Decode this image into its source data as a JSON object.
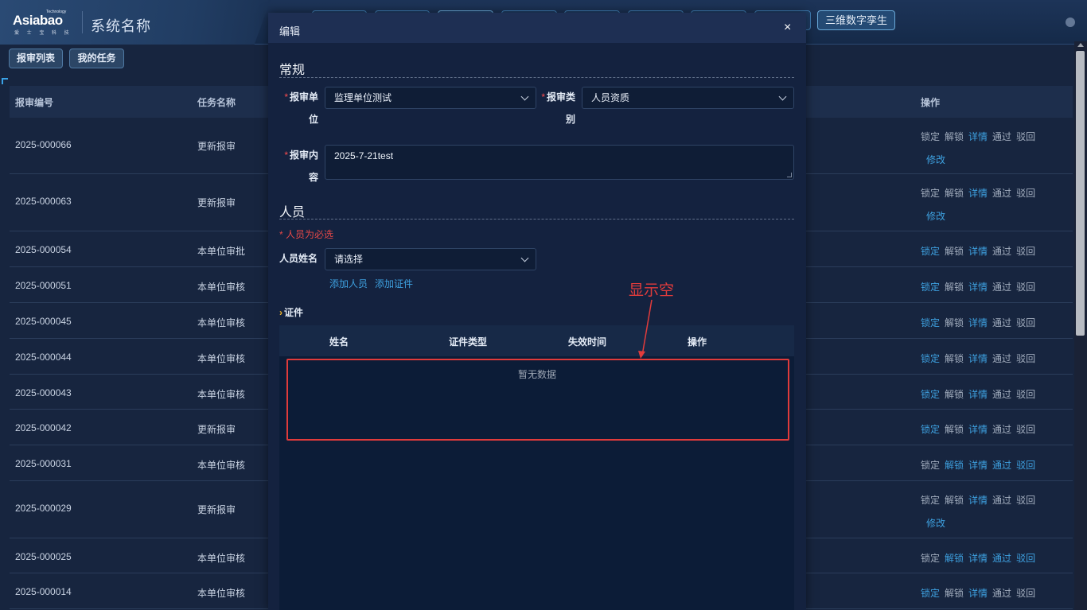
{
  "header": {
    "logo_text": "Asiabao",
    "logo_tech": "Technology",
    "logo_sub": "爱 士 宝 科 技",
    "system_name": "系统名称",
    "tabs": [
      "",
      "",
      "",
      "",
      "",
      "",
      "",
      ""
    ],
    "last_tab": "三维数字孪生"
  },
  "subtabs": [
    "报审列表",
    "我的任务"
  ],
  "table": {
    "headers": [
      "报审编号",
      "任务名称",
      "操作"
    ],
    "ops_labels": [
      "锁定",
      "解锁",
      "详情",
      "通过",
      "驳回",
      "修改"
    ],
    "rows": [
      {
        "id": "2025-000066",
        "name": "更新报审",
        "blue_ops": [
          "详情"
        ],
        "edit": true
      },
      {
        "id": "2025-000063",
        "name": "更新报审",
        "blue_ops": [
          "详情"
        ],
        "edit": true
      },
      {
        "id": "2025-000054",
        "name": "本单位审批",
        "blue_ops": [
          "锁定",
          "详情"
        ],
        "edit": false
      },
      {
        "id": "2025-000051",
        "name": "本单位审核",
        "blue_ops": [
          "锁定",
          "详情"
        ],
        "edit": false
      },
      {
        "id": "2025-000045",
        "name": "本单位审核",
        "blue_ops": [
          "锁定",
          "详情"
        ],
        "edit": false
      },
      {
        "id": "2025-000044",
        "name": "本单位审核",
        "blue_ops": [
          "锁定",
          "详情"
        ],
        "edit": false
      },
      {
        "id": "2025-000043",
        "name": "本单位审核",
        "blue_ops": [
          "锁定",
          "详情"
        ],
        "edit": false
      },
      {
        "id": "2025-000042",
        "name": "更新报审",
        "blue_ops": [
          "锁定",
          "详情"
        ],
        "edit": false
      },
      {
        "id": "2025-000031",
        "name": "本单位审核",
        "blue_ops": [
          "解锁",
          "详情",
          "通过",
          "驳回"
        ],
        "edit": false
      },
      {
        "id": "2025-000029",
        "name": "更新报审",
        "blue_ops": [
          "详情"
        ],
        "edit": true
      },
      {
        "id": "2025-000025",
        "name": "本单位审核",
        "blue_ops": [
          "解锁",
          "详情",
          "通过",
          "驳回"
        ],
        "edit": false
      },
      {
        "id": "2025-000014",
        "name": "本单位审核",
        "blue_ops": [
          "锁定",
          "详情"
        ],
        "edit": false
      }
    ]
  },
  "modal": {
    "title": "编辑",
    "close": "×",
    "section_general": "常规",
    "unit_label_1": "报审单",
    "unit_label_2": "位",
    "unit_value": "监理单位测试",
    "type_label_1": "报审类",
    "type_label_2": "别",
    "type_value": "人员资质",
    "content_label_1": "报审内",
    "content_label_2": "容",
    "content_value": "2025-7-21test",
    "section_person": "人员",
    "required_note": "* 人员为必选",
    "person_label": "人员姓名",
    "person_placeholder": "请选择",
    "add_person": "添加人员",
    "add_cert": "添加证件",
    "cert_title": "证件",
    "cert_headers": [
      "姓名",
      "证件类型",
      "失效时间",
      "操作"
    ],
    "empty_text": "暂无数据"
  },
  "annotation": {
    "text": "显示空",
    "color": "#e23c3c"
  },
  "colors": {
    "accent_blue": "#3ea1e0",
    "required_red": "#ff4d4f",
    "page_bg": "#17253f"
  }
}
